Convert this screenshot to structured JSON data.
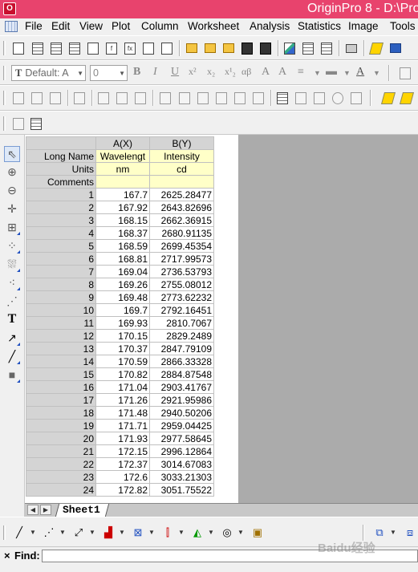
{
  "window": {
    "title": "OriginPro 8 - D:\\Pro",
    "app_icon": "origin-app-icon"
  },
  "menu": [
    "File",
    "Edit",
    "View",
    "Plot",
    "Column",
    "Worksheet",
    "Analysis",
    "Statistics",
    "Image",
    "Tools"
  ],
  "format_toolbar": {
    "font": "Default: A",
    "font_prefix": "T",
    "size": "0",
    "bold": "B",
    "italic": "I",
    "underline": "U",
    "superscript": "x²",
    "subscript": "x₂",
    "supsub": "x¹₂",
    "greek": "αβ",
    "grow_font": "A",
    "align": "≡",
    "line": "▬",
    "font_color": "A"
  },
  "worksheet": {
    "columns": [
      {
        "header": "A(X)",
        "long_name": "Wavelengt",
        "units": "nm",
        "comments": ""
      },
      {
        "header": "B(Y)",
        "long_name": "Intensity",
        "units": "cd",
        "comments": ""
      }
    ],
    "label_rows": {
      "long_name": "Long Name",
      "units": "Units",
      "comments": "Comments"
    },
    "rows": [
      [
        "1",
        "167.7",
        "2625.28477"
      ],
      [
        "2",
        "167.92",
        "2643.82696"
      ],
      [
        "3",
        "168.15",
        "2662.36915"
      ],
      [
        "4",
        "168.37",
        "2680.91135"
      ],
      [
        "5",
        "168.59",
        "2699.45354"
      ],
      [
        "6",
        "168.81",
        "2717.99573"
      ],
      [
        "7",
        "169.04",
        "2736.53793"
      ],
      [
        "8",
        "169.26",
        "2755.08012"
      ],
      [
        "9",
        "169.48",
        "2773.62232"
      ],
      [
        "10",
        "169.7",
        "2792.16451"
      ],
      [
        "11",
        "169.93",
        "2810.7067"
      ],
      [
        "12",
        "170.15",
        "2829.2489"
      ],
      [
        "13",
        "170.37",
        "2847.79109"
      ],
      [
        "14",
        "170.59",
        "2866.33328"
      ],
      [
        "15",
        "170.82",
        "2884.87548"
      ],
      [
        "16",
        "171.04",
        "2903.41767"
      ],
      [
        "17",
        "171.26",
        "2921.95986"
      ],
      [
        "18",
        "171.48",
        "2940.50206"
      ],
      [
        "19",
        "171.71",
        "2959.04425"
      ],
      [
        "20",
        "171.93",
        "2977.58645"
      ],
      [
        "21",
        "172.15",
        "2996.12864"
      ],
      [
        "22",
        "172.37",
        "3014.67083"
      ],
      [
        "23",
        "172.6",
        "3033.21303"
      ],
      [
        "24",
        "172.82",
        "3051.75522"
      ]
    ]
  },
  "sheet_tab": "Sheet1",
  "find": {
    "label": "Find:",
    "close": "×",
    "value": ""
  },
  "watermark": "Baidu经验"
}
